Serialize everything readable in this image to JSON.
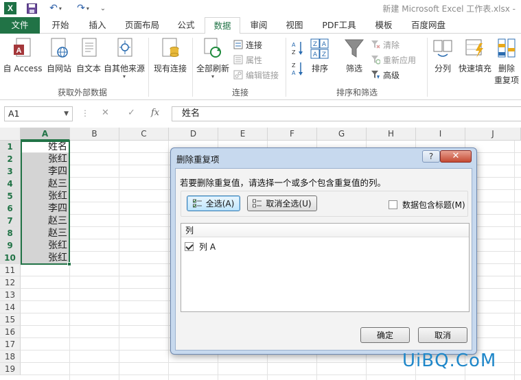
{
  "app": {
    "logo_letter": "X",
    "window_title": "新建 Microsoft Excel 工作表.xlsx -",
    "accent_color": "#217346"
  },
  "tabs": [
    {
      "label": "文件"
    },
    {
      "label": "开始"
    },
    {
      "label": "插入"
    },
    {
      "label": "页面布局"
    },
    {
      "label": "公式"
    },
    {
      "label": "数据"
    },
    {
      "label": "审阅"
    },
    {
      "label": "视图"
    },
    {
      "label": "PDF工具"
    },
    {
      "label": "模板"
    },
    {
      "label": "百度网盘"
    }
  ],
  "ribbon": {
    "get_external": {
      "label": "获取外部数据",
      "buttons": [
        "自 Access",
        "自网站",
        "自文本",
        "自其他来源"
      ]
    },
    "existing_connections": "现有连接",
    "connections": {
      "label": "连接",
      "refresh_all": "全部刷新",
      "small": [
        "连接",
        "属性",
        "编辑链接"
      ]
    },
    "sort_filter": {
      "label": "排序和筛选",
      "sort": "排序",
      "filter": "筛选",
      "small": [
        "清除",
        "重新应用",
        "高级"
      ]
    },
    "data_tools": {
      "text_to_columns": "分列",
      "flash_fill": "快速填充",
      "remove_duplicates_line1": "删除",
      "remove_duplicates_line2": "重复项"
    }
  },
  "formula_bar": {
    "name_box": "A1",
    "fx_label": "fx",
    "content": "姓名"
  },
  "sheet": {
    "columns": [
      "A",
      "B",
      "C",
      "D",
      "E",
      "F",
      "G",
      "H",
      "I",
      "J"
    ],
    "rows": [
      "1",
      "2",
      "3",
      "4",
      "5",
      "6",
      "7",
      "8",
      "9",
      "10",
      "11",
      "12",
      "13",
      "14",
      "15",
      "16",
      "17",
      "18",
      "19"
    ],
    "column_a_values": [
      "姓名",
      "张红",
      "李四",
      "赵三",
      "张红",
      "李四",
      "赵三",
      "赵三",
      "张红",
      "张红"
    ]
  },
  "dialog": {
    "title": "删除重复项",
    "help_label": "?",
    "close_label": "✕",
    "prompt": "若要删除重复值，请选择一个或多个包含重复值的列。",
    "select_all": "全选(A)",
    "unselect_all": "取消全选(U)",
    "has_headers_label": "数据包含标题(M)",
    "has_headers_checked": false,
    "column_header": "列",
    "columns": [
      {
        "label": "列 A",
        "checked": true
      }
    ],
    "ok": "确定",
    "cancel": "取消"
  },
  "watermark": "UiBQ.CoM"
}
